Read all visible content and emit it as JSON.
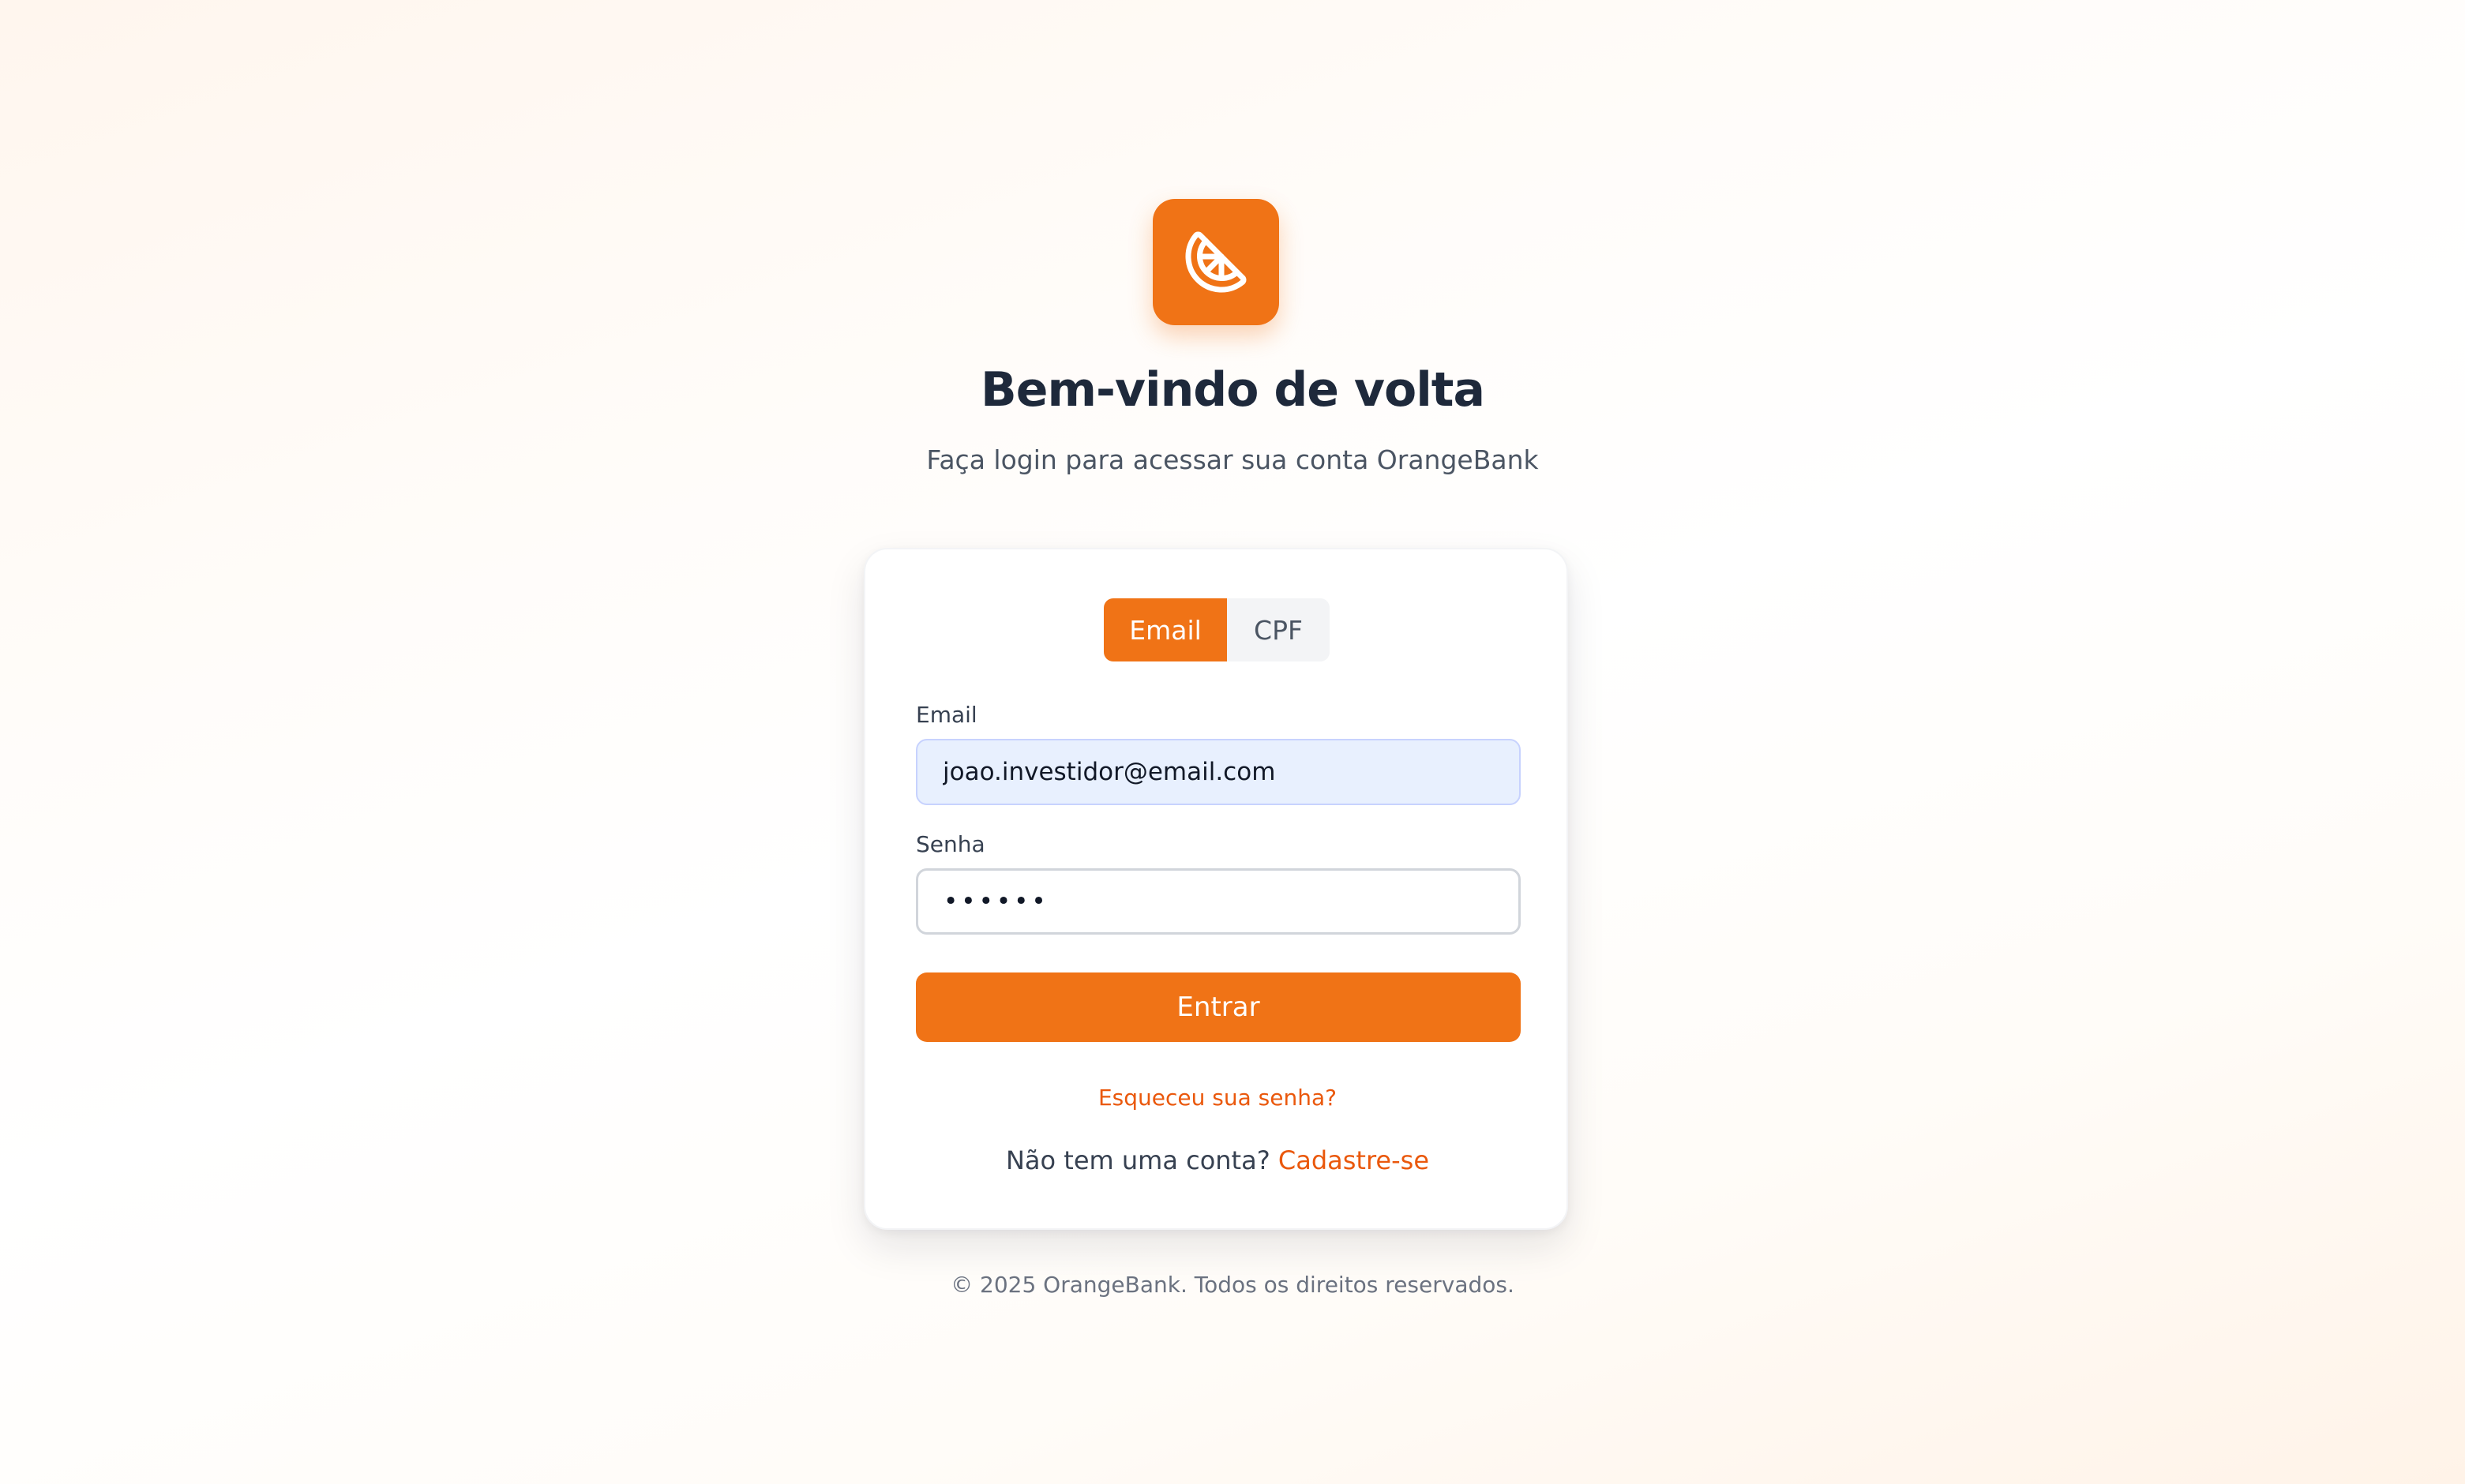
{
  "brand": {
    "logo_icon": "citrus-slice-icon",
    "accent_color": "#f07316",
    "link_color": "#ea580c"
  },
  "header": {
    "title": "Bem-vindo de volta",
    "subtitle": "Faça login para acessar sua conta OrangeBank"
  },
  "login_form": {
    "tabs": [
      {
        "label": "Email",
        "selected": true
      },
      {
        "label": "CPF",
        "selected": false
      }
    ],
    "email_label": "Email",
    "email_value": "joao.investidor@email.com",
    "password_label": "Senha",
    "password_value": "••••••",
    "submit_label": "Entrar",
    "forgot_password_link": "Esqueceu sua senha?",
    "signup_prompt": "Não tem uma conta?",
    "signup_link": "Cadastre-se"
  },
  "footer": {
    "copyright": "© 2025 OrangeBank. Todos os direitos reservados."
  }
}
